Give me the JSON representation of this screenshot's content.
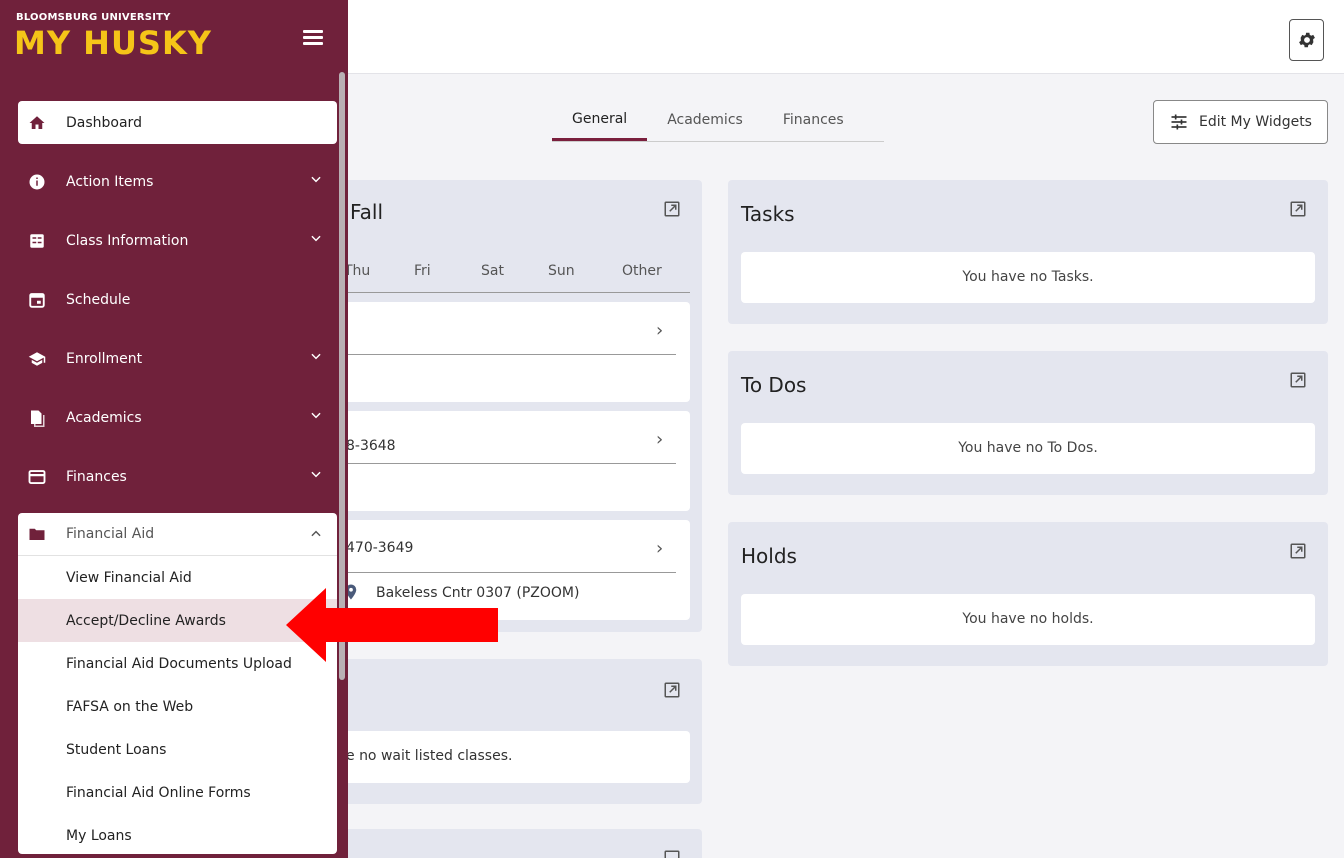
{
  "header": {
    "logo_small": "BLOOMSBURG UNIVERSITY",
    "logo_big": "MY HUSKY"
  },
  "tabs": [
    {
      "label": "General",
      "active": true
    },
    {
      "label": "Academics",
      "active": false
    },
    {
      "label": "Finances",
      "active": false
    }
  ],
  "edit_widgets_label": "Edit My Widgets",
  "schedule_card": {
    "title_partial": "Fall",
    "days": [
      "Thu",
      "Fri",
      "Sat",
      "Sun",
      "Other"
    ],
    "rows": [
      {
        "text": ""
      },
      {
        "text": "8-3648"
      },
      {
        "text": "470-3649",
        "location": "Bakeless Cntr 0307 (PZOOM)"
      }
    ]
  },
  "waitlist_card": {
    "empty_text": "e no wait listed classes."
  },
  "tasks_card": {
    "title": "Tasks",
    "empty_text": "You have no Tasks."
  },
  "todos_card": {
    "title": "To Dos",
    "empty_text": "You have no To Dos."
  },
  "holds_card": {
    "title": "Holds",
    "empty_text": "You have no holds."
  },
  "sidebar": {
    "items": [
      {
        "label": "Dashboard",
        "icon": "home-icon",
        "selected": true
      },
      {
        "label": "Action Items",
        "icon": "info-icon",
        "expandable": true
      },
      {
        "label": "Class Information",
        "icon": "class-info-icon",
        "expandable": true
      },
      {
        "label": "Schedule",
        "icon": "calendar-icon"
      },
      {
        "label": "Enrollment",
        "icon": "graduation-cap-icon",
        "expandable": true
      },
      {
        "label": "Academics",
        "icon": "documents-icon",
        "expandable": true
      },
      {
        "label": "Finances",
        "icon": "credit-card-icon",
        "expandable": true
      }
    ],
    "financial_aid": {
      "label": "Financial Aid",
      "icon": "folder-icon",
      "expanded": true,
      "subitems": [
        {
          "label": "View Financial Aid"
        },
        {
          "label": "Accept/Decline Awards",
          "highlighted": true
        },
        {
          "label": "Financial Aid Documents Upload"
        },
        {
          "label": "FAFSA on the Web"
        },
        {
          "label": "Student Loans"
        },
        {
          "label": "Financial Aid Online Forms"
        },
        {
          "label": "My Loans"
        }
      ]
    }
  },
  "colors": {
    "sidebar": "#70213b",
    "accent_gold": "#f5c518",
    "card_bg": "#e4e6ef",
    "arrow": "#ff0000"
  }
}
